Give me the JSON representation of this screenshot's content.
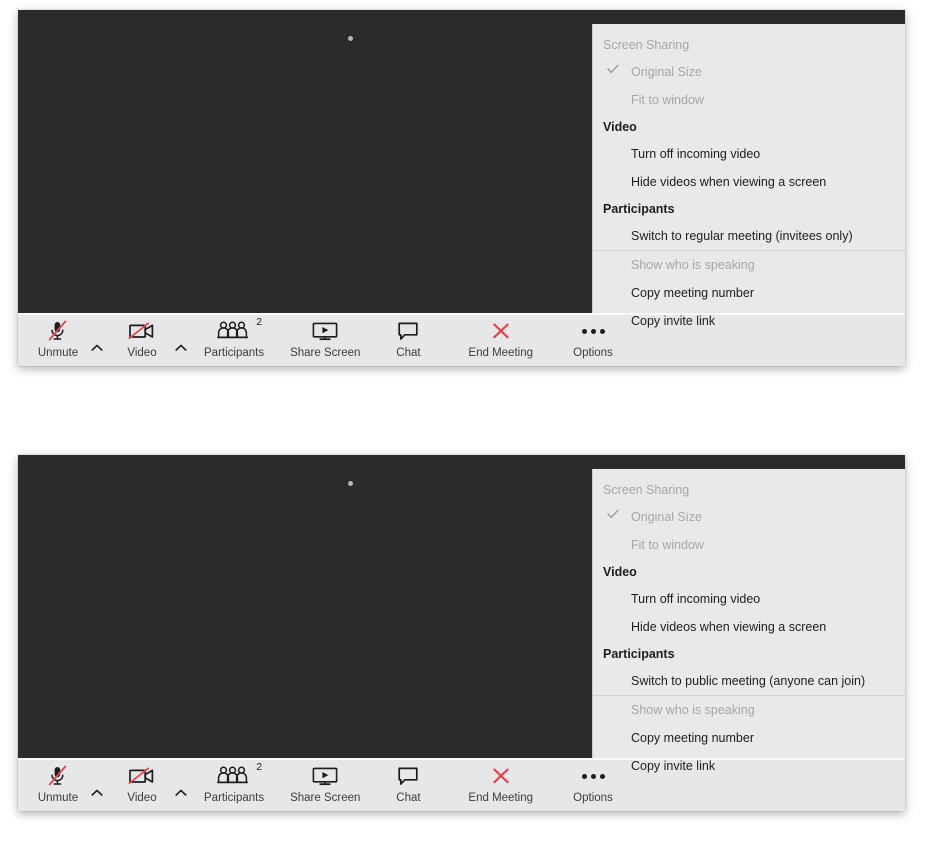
{
  "app": {
    "name": "Zoom Meeting",
    "accent_red": "#e0474c",
    "video_bg": "#2b2b2b",
    "panel_bg": "#e9e9eb",
    "toolbar_bg": "#e7e7e9",
    "disabled_text": "#a6a6a8",
    "text": "#1d1d1d"
  },
  "windows": [
    {
      "id": "window-invitees",
      "menu": {
        "sections": [
          {
            "heading": "Screen Sharing",
            "heading_disabled": true,
            "items": [
              {
                "label": "Original Size",
                "checked": true,
                "disabled": true,
                "separator_below": false
              },
              {
                "label": "Fit to window",
                "checked": false,
                "disabled": true,
                "separator_below": false
              }
            ]
          },
          {
            "heading": "Video",
            "heading_disabled": false,
            "items": [
              {
                "label": "Turn off incoming video",
                "checked": false,
                "disabled": false,
                "separator_below": false
              },
              {
                "label": "Hide videos when viewing a screen",
                "checked": false,
                "disabled": false,
                "separator_below": false
              }
            ]
          },
          {
            "heading": "Participants",
            "heading_disabled": false,
            "items": [
              {
                "label": "Switch to regular meeting (invitees only)",
                "checked": false,
                "disabled": false,
                "separator_below": true
              },
              {
                "label": "Show who is speaking",
                "checked": false,
                "disabled": true,
                "separator_below": false
              },
              {
                "label": "Copy meeting number",
                "checked": false,
                "disabled": false,
                "separator_below": false
              },
              {
                "label": "Copy invite link",
                "checked": false,
                "disabled": false,
                "separator_below": false
              }
            ]
          }
        ]
      },
      "toolbar": {
        "mute": {
          "label": "Unmute",
          "icon": "microphone-muted-icon"
        },
        "video": {
          "label": "Video",
          "icon": "video-camera-off-icon"
        },
        "participants": {
          "label": "Participants",
          "icon": "participants-icon",
          "count": "2"
        },
        "share": {
          "label": "Share Screen",
          "icon": "share-screen-icon"
        },
        "chat": {
          "label": "Chat",
          "icon": "chat-bubble-icon"
        },
        "end": {
          "label": "End Meeting",
          "icon": "close-x-icon"
        },
        "options": {
          "label": "Options",
          "icon": "more-options-icon"
        }
      }
    },
    {
      "id": "window-public",
      "menu": {
        "sections": [
          {
            "heading": "Screen Sharing",
            "heading_disabled": true,
            "items": [
              {
                "label": "Original Size",
                "checked": true,
                "disabled": true,
                "separator_below": false
              },
              {
                "label": "Fit to window",
                "checked": false,
                "disabled": true,
                "separator_below": false
              }
            ]
          },
          {
            "heading": "Video",
            "heading_disabled": false,
            "items": [
              {
                "label": "Turn off incoming video",
                "checked": false,
                "disabled": false,
                "separator_below": false
              },
              {
                "label": "Hide videos when viewing a screen",
                "checked": false,
                "disabled": false,
                "separator_below": false
              }
            ]
          },
          {
            "heading": "Participants",
            "heading_disabled": false,
            "items": [
              {
                "label": "Switch to public meeting (anyone can join)",
                "checked": false,
                "disabled": false,
                "separator_below": true
              },
              {
                "label": "Show who is speaking",
                "checked": false,
                "disabled": true,
                "separator_below": false
              },
              {
                "label": "Copy meeting number",
                "checked": false,
                "disabled": false,
                "separator_below": false
              },
              {
                "label": "Copy invite link",
                "checked": false,
                "disabled": false,
                "separator_below": false
              }
            ]
          }
        ]
      },
      "toolbar": {
        "mute": {
          "label": "Unmute",
          "icon": "microphone-muted-icon"
        },
        "video": {
          "label": "Video",
          "icon": "video-camera-off-icon"
        },
        "participants": {
          "label": "Participants",
          "icon": "participants-icon",
          "count": "2"
        },
        "share": {
          "label": "Share Screen",
          "icon": "share-screen-icon"
        },
        "chat": {
          "label": "Chat",
          "icon": "chat-bubble-icon"
        },
        "end": {
          "label": "End Meeting",
          "icon": "close-x-icon"
        },
        "options": {
          "label": "Options",
          "icon": "more-options-icon"
        }
      }
    }
  ]
}
